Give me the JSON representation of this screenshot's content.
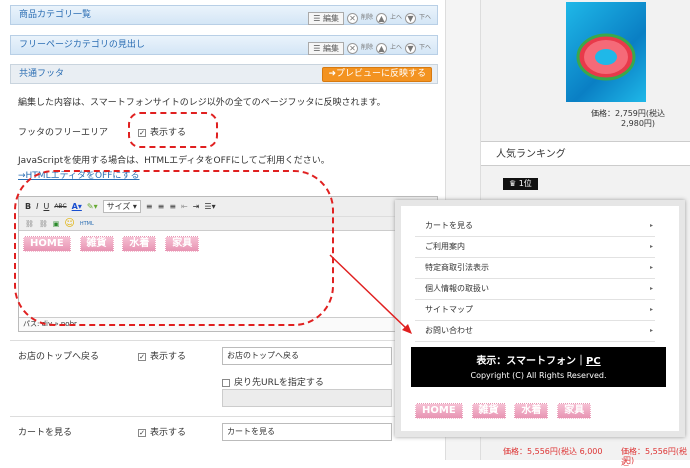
{
  "bars": [
    {
      "title": "商品カテゴリ一覧",
      "edit": "☰ 編集",
      "delete": "削除",
      "up": "上へ",
      "down": "下へ"
    },
    {
      "title": "フリーページカテゴリの見出し",
      "edit": "☰ 編集",
      "delete": "削除",
      "up": "上へ",
      "down": "下へ"
    }
  ],
  "footer_section": {
    "title": "共通フッタ",
    "preview_button": "➜プレビューに反映する",
    "description": "編集した内容は、スマートフォンサイトのレジ以外の全てのページフッタに反映されます。",
    "free_area_label": "フッタのフリーエリア",
    "show_label": "表示する",
    "js_note": "JavaScriptを使用する場合は、HTMLエディタをOFFにしてご利用ください。",
    "html_link": "→HTMLエディタをOFFにする"
  },
  "editor": {
    "bold": "B",
    "italic": "I",
    "underline": "U",
    "strike": "ABC",
    "size": "サイズ",
    "html": "HTML",
    "status": "パス: div » nobr",
    "buttons": [
      "HOME",
      "雑貨",
      "水着",
      "家具"
    ]
  },
  "rows": [
    {
      "label": "お店のトップへ戻る",
      "show": "表示する",
      "value": "お店のトップへ戻る",
      "url_option": "戻り先URLを指定する"
    },
    {
      "label": "カートを見る",
      "show": "表示する",
      "value": "カートを見る"
    }
  ],
  "popup": {
    "menu": [
      "カートを見る",
      "ご利用案内",
      "特定商取引法表示",
      "個人情報の取扱い",
      "サイトマップ",
      "お問い合わせ"
    ],
    "display_line": "表示：スマートフォン｜",
    "display_pc": "PC",
    "copyright": "Copyright (C) All Rights Reserved.",
    "buttons": [
      "HOME",
      "雑貨",
      "水着",
      "家具"
    ]
  },
  "right": {
    "price": "価格：2,759円(税込",
    "price2": "2,980円)",
    "ranking_title": "人気ランキング",
    "rank_badge": "♛ 1位",
    "bottom_price1": "価格：5,556円(税込 6,000",
    "bottom_price2": "価格：5,556円(税込",
    "bottom_price_tail": "円)"
  },
  "colors": {
    "accent": "#f39321",
    "link": "#2a6db3",
    "highlight": "#e02020",
    "pink": "#e894b3"
  }
}
